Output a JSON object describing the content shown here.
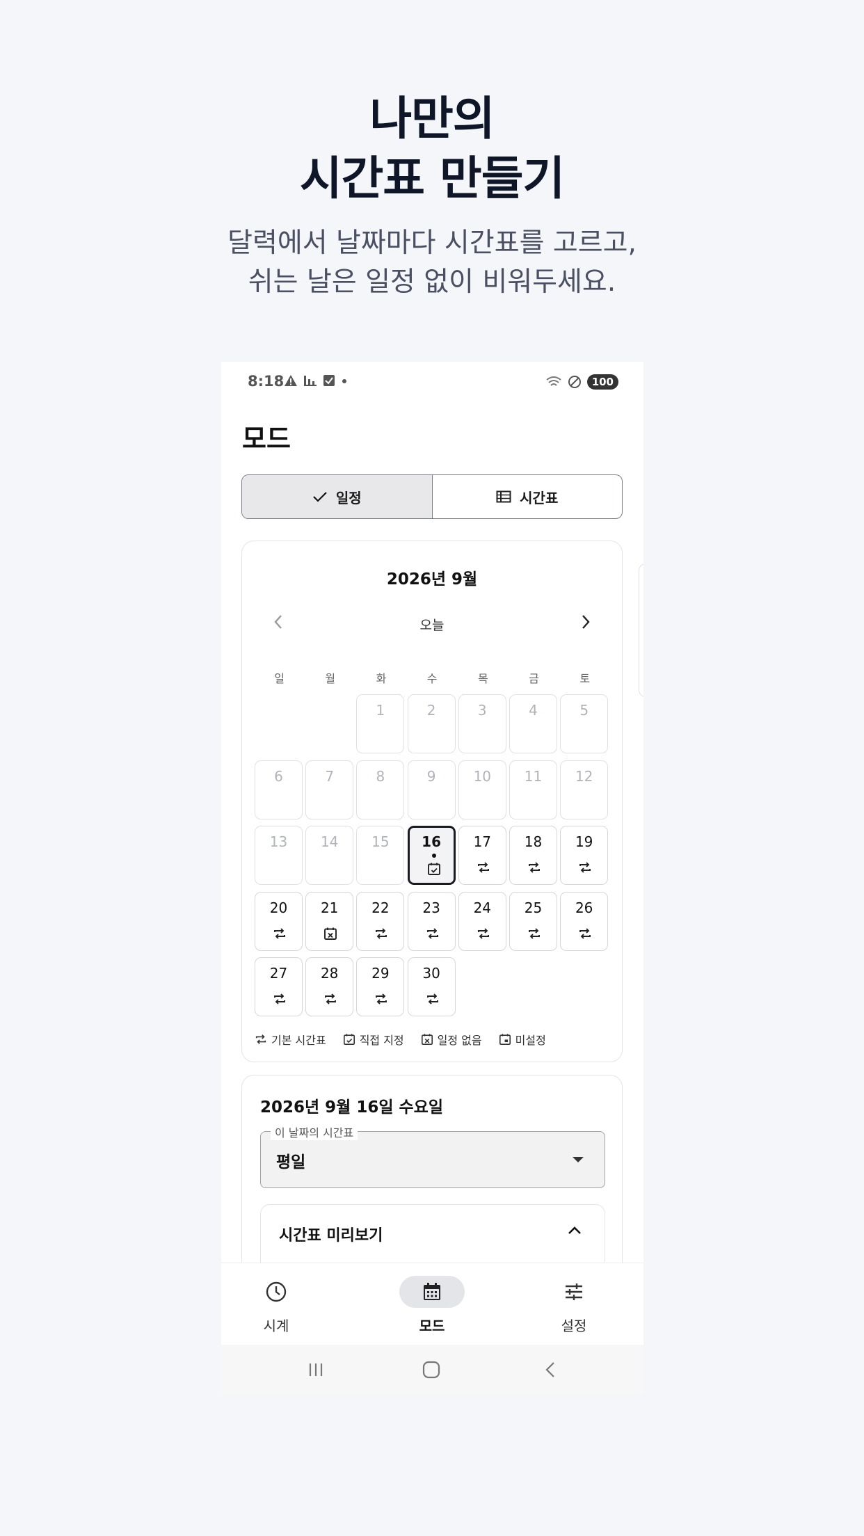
{
  "hero": {
    "title_line1": "나만의",
    "title_line2": "시간표 만들기",
    "subtitle_line1": "달력에서 날짜마다 시간표를 고르고,",
    "subtitle_line2": "쉬는 날은 일정 없이 비워두세요."
  },
  "status_bar": {
    "time": "8:18",
    "battery": "100"
  },
  "page": {
    "title": "모드"
  },
  "segmented": {
    "schedule_label": "일정",
    "timetable_label": "시간표"
  },
  "calendar": {
    "month_title": "2026년 9월",
    "today_label": "오늘",
    "weekdays": [
      "일",
      "월",
      "화",
      "수",
      "목",
      "금",
      "토"
    ],
    "days": [
      {
        "n": "1",
        "s": "dim"
      },
      {
        "n": "2",
        "s": "dim"
      },
      {
        "n": "3",
        "s": "dim"
      },
      {
        "n": "4",
        "s": "dim"
      },
      {
        "n": "5",
        "s": "dim"
      },
      {
        "n": "6",
        "s": "dim"
      },
      {
        "n": "7",
        "s": "dim"
      },
      {
        "n": "8",
        "s": "dim"
      },
      {
        "n": "9",
        "s": "dim"
      },
      {
        "n": "10",
        "s": "dim"
      },
      {
        "n": "11",
        "s": "dim"
      },
      {
        "n": "12",
        "s": "dim"
      },
      {
        "n": "13",
        "s": "dim"
      },
      {
        "n": "14",
        "s": "dim"
      },
      {
        "n": "15",
        "s": "dim"
      },
      {
        "n": "16",
        "s": "custom"
      },
      {
        "n": "17",
        "s": "repeat"
      },
      {
        "n": "18",
        "s": "repeat"
      },
      {
        "n": "19",
        "s": "repeat"
      },
      {
        "n": "20",
        "s": "repeat"
      },
      {
        "n": "21",
        "s": "none"
      },
      {
        "n": "22",
        "s": "repeat"
      },
      {
        "n": "23",
        "s": "repeat"
      },
      {
        "n": "24",
        "s": "repeat"
      },
      {
        "n": "25",
        "s": "repeat"
      },
      {
        "n": "26",
        "s": "repeat"
      },
      {
        "n": "27",
        "s": "repeat"
      },
      {
        "n": "28",
        "s": "repeat"
      },
      {
        "n": "29",
        "s": "repeat"
      },
      {
        "n": "30",
        "s": "repeat"
      }
    ],
    "first_weekday_index": 2,
    "today": "16",
    "legend": {
      "default": "기본 시간표",
      "custom": "직접 지정",
      "none": "일정 없음",
      "unset": "미설정"
    }
  },
  "detail": {
    "date": "2026년 9월 16일 수요일",
    "select_label": "이 날짜의 시간표",
    "select_value": "평일",
    "preview_title": "시간표 미리보기"
  },
  "bottom_nav": {
    "clock": "시계",
    "mode": "모드",
    "settings": "설정"
  },
  "colors": {
    "background": "#f4f6fa",
    "text_dark": "#0f1628",
    "subtitle": "#4a5061"
  }
}
